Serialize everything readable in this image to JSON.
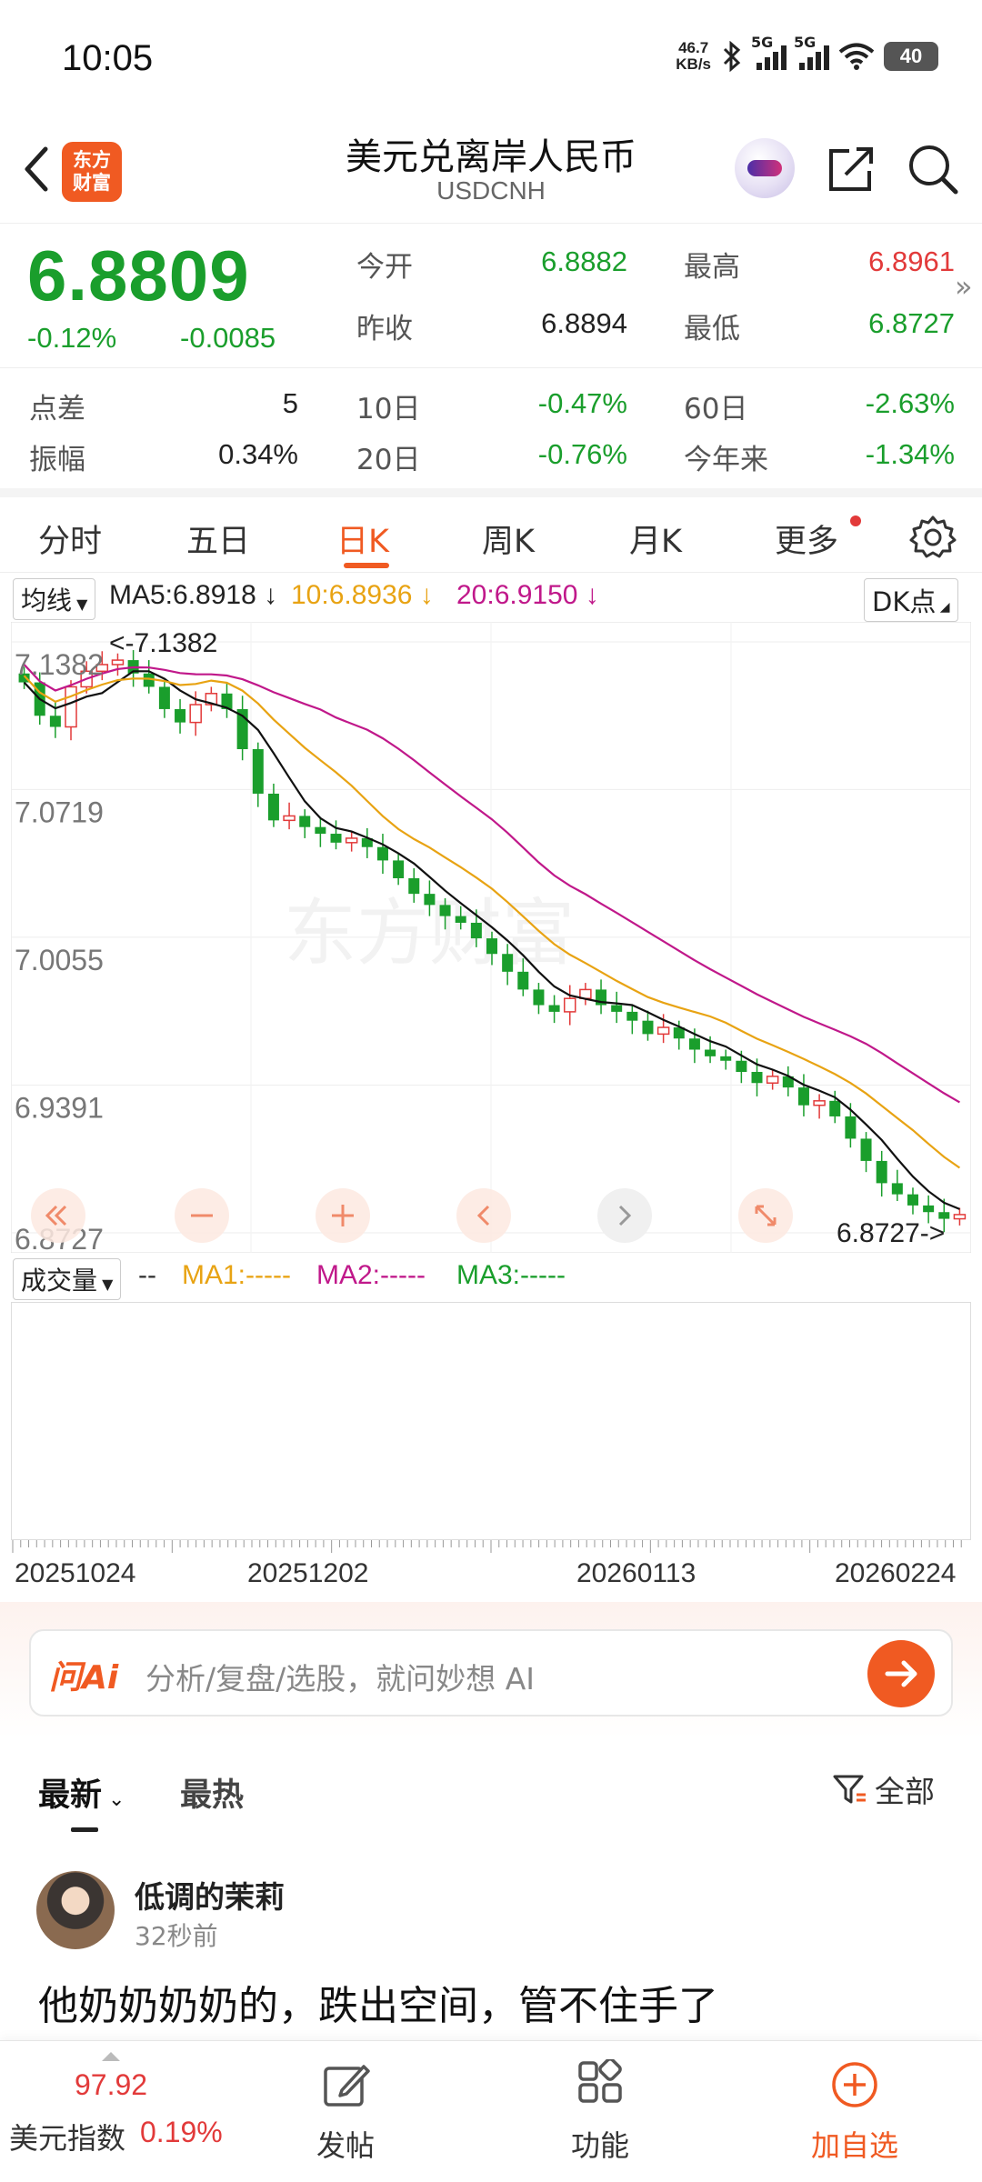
{
  "status_bar": {
    "time": "10:05",
    "net_speed_value": "46.7",
    "net_speed_unit": "KB/s",
    "net1": "5G",
    "net2": "5G",
    "battery": "40"
  },
  "header": {
    "logo_text_1": "东方",
    "logo_text_2": "财富",
    "title": "美元兑离岸人民币",
    "subtitle": "USDCNH"
  },
  "quote": {
    "price": "6.8809",
    "change_pct": "-0.12%",
    "change": "-0.0085",
    "open_label": "今开",
    "open": "6.8882",
    "high_label": "最高",
    "high": "6.8961",
    "prev_close_label": "昨收",
    "prev_close": "6.8894",
    "low_label": "最低",
    "low": "6.8727",
    "spread_label": "点差",
    "spread": "5",
    "d10_label": "10日",
    "d10": "-0.47%",
    "d60_label": "60日",
    "d60": "-2.63%",
    "amplitude_label": "振幅",
    "amplitude": "0.34%",
    "d20_label": "20日",
    "d20": "-0.76%",
    "ytd_label": "今年来",
    "ytd": "-1.34%",
    "colors": {
      "up": "#e23a3a",
      "down": "#1a9e2c"
    }
  },
  "tabs": [
    "分时",
    "五日",
    "日K",
    "周K",
    "月K",
    "更多"
  ],
  "active_tab": "日K",
  "ma_legend": {
    "selector": "均线",
    "ma5": "MA5:6.8918 ↓",
    "ma10": "10:6.8936 ↓",
    "ma20": "20:6.9150 ↓",
    "dk": "DK点"
  },
  "chart_data": {
    "type": "candlestick",
    "y_ticks": [
      "7.1382",
      "7.0719",
      "7.0055",
      "6.9391",
      "6.8727"
    ],
    "ylim": [
      6.8727,
      7.1382
    ],
    "max_marker": "7.1382",
    "min_marker": "6.8727",
    "x_ticks": [
      "20251024",
      "20251202",
      "20260113",
      "20260224"
    ],
    "approx_close_path": [
      7.12,
      7.105,
      7.1,
      7.118,
      7.125,
      7.128,
      7.13,
      7.124,
      7.118,
      7.108,
      7.102,
      7.11,
      7.115,
      7.108,
      7.09,
      7.07,
      7.058,
      7.06,
      7.055,
      7.052,
      7.048,
      7.05,
      7.046,
      7.04,
      7.032,
      7.025,
      7.02,
      7.015,
      7.012,
      7.005,
      6.998,
      6.99,
      6.982,
      6.975,
      6.972,
      6.978,
      6.982,
      6.975,
      6.972,
      6.968,
      6.962,
      6.965,
      6.96,
      6.955,
      6.952,
      6.95,
      6.945,
      6.94,
      6.943,
      6.938,
      6.93,
      6.932,
      6.925,
      6.915,
      6.905,
      6.895,
      6.89,
      6.885,
      6.882,
      6.879,
      6.8809
    ],
    "ma_colors": {
      "ma5": "#111111",
      "ma10": "#e8a313",
      "ma20": "#c0188a"
    }
  },
  "volume_legend": {
    "selector": "成交量",
    "dash": "--",
    "ma1": "MA1:-----",
    "ma2": "MA2:-----",
    "ma3": "MA3:-----"
  },
  "ai_bar": {
    "logo": "问Ai",
    "placeholder": "分析/复盘/选股，就问妙想 AI"
  },
  "feed": {
    "tab_latest": "最新",
    "tab_hot": "最热",
    "filter": "全部",
    "post": {
      "user": "低调的茉莉",
      "time": "32秒前",
      "text": "他奶奶奶奶的，跌出空间，管不住手了"
    }
  },
  "bottom_nav": {
    "index_value": "97.92",
    "index_label": "美元指数",
    "index_pct": "0.19%",
    "post": "发帖",
    "func": "功能",
    "add": "加自选"
  }
}
